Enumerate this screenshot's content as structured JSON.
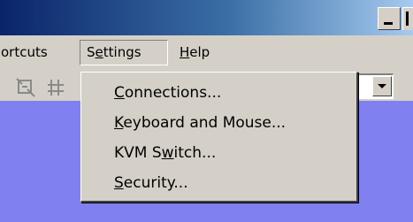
{
  "menubar": {
    "items": [
      {
        "label": "ortcuts"
      },
      {
        "pre": "S",
        "accel": "e",
        "post": "ttings"
      },
      {
        "pre": "",
        "accel": "H",
        "post": "elp"
      }
    ]
  },
  "settings_menu": {
    "items": [
      {
        "pre": "",
        "accel": "C",
        "post": "onnections..."
      },
      {
        "pre": "",
        "accel": "K",
        "post": "eyboard and Mouse..."
      },
      {
        "pre": "KVM S",
        "accel": "w",
        "post": "itch..."
      },
      {
        "pre": "",
        "accel": "S",
        "post": "ecurity..."
      }
    ]
  },
  "colors": {
    "titlebar_start": "#0a246a",
    "menu_face": "#d4d0c8",
    "client_background": "#8080f0"
  },
  "icons": [
    "fit-screen-icon",
    "grid-icon",
    "minimize-icon",
    "chevron-down-icon"
  ]
}
